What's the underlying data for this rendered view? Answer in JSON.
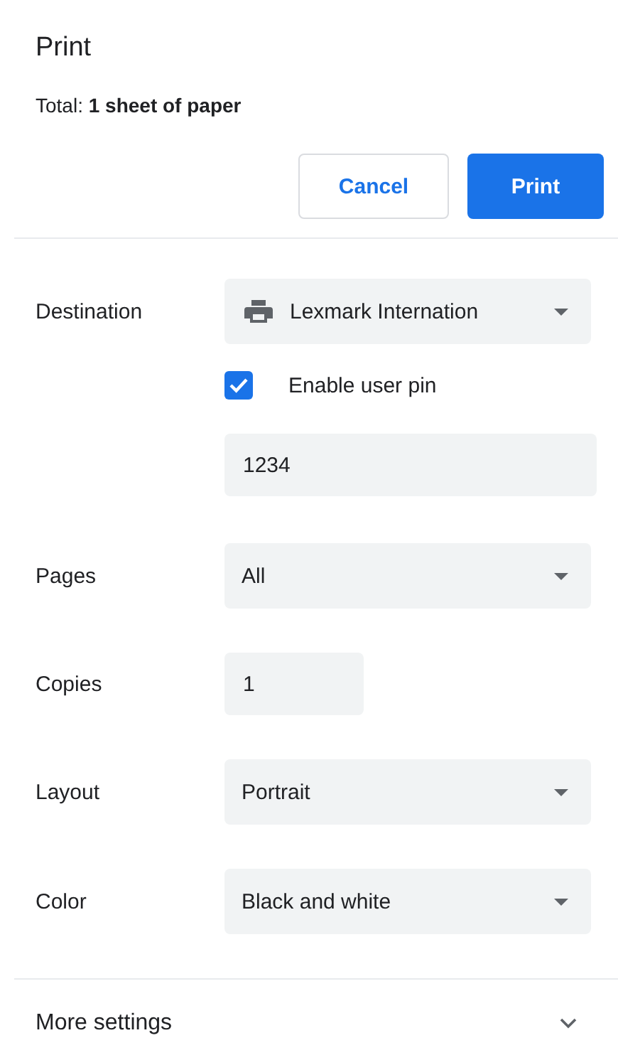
{
  "title": "Print",
  "summary": "Total: **1 sheet of paper**",
  "buttons": [
    {
      "label": "Cancel",
      "kind": "secondary"
    },
    {
      "label": "Print",
      "kind": "primary"
    }
  ],
  "settings": [
    {
      "kind": "destination",
      "label": "Destination",
      "value": "Lexmark Internation"
    },
    {
      "kind": "checkbox",
      "text": "Enable user pin",
      "checked": true
    },
    {
      "kind": "input",
      "value": "1234"
    },
    {
      "kind": "select",
      "label": "Pages",
      "value": "All"
    },
    {
      "kind": "number",
      "label": "Copies",
      "value": "1"
    },
    {
      "kind": "select",
      "label": "Layout",
      "value": "Portrait"
    },
    {
      "kind": "select",
      "label": "Color",
      "value": "Black and white"
    }
  ],
  "more_settings": {
    "label": "More settings",
    "expanded": false
  }
}
